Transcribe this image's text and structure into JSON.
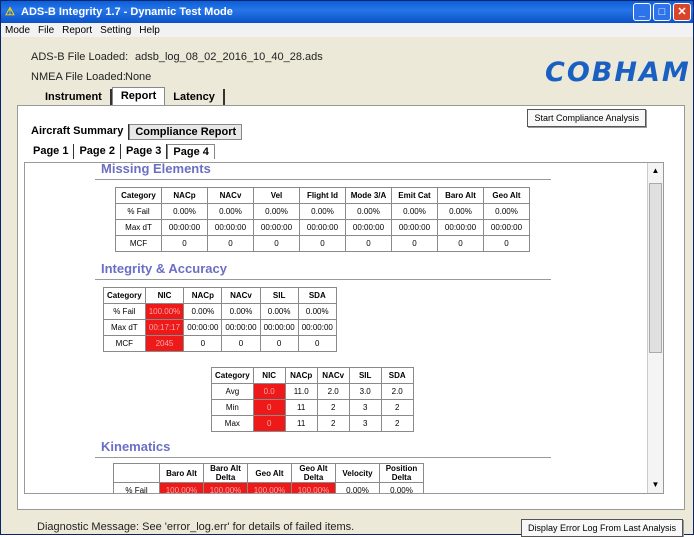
{
  "window": {
    "title": "ADS-B Integrity 1.7 - Dynamic Test Mode"
  },
  "menu": [
    "Mode",
    "File",
    "Report",
    "Setting",
    "Help"
  ],
  "files": {
    "adsb_label": "ADS-B File Loaded:",
    "adsb_value": "adsb_log_08_02_2016_10_40_28.ads",
    "nmea_label": "NMEA File Loaded:",
    "nmea_value": "None"
  },
  "logo": "COBHAM",
  "tabs": [
    "Instrument",
    "Report",
    "Latency"
  ],
  "start_button": "Start Compliance Analysis",
  "subtabs": [
    "Aircraft Summary",
    "Compliance Report"
  ],
  "pages": [
    "Page 1",
    "Page 2",
    "Page 3",
    "Page 4"
  ],
  "missing": {
    "title": "Missing Elements",
    "headers": [
      "Category",
      "NACp",
      "NACv",
      "Vel",
      "Flight Id",
      "Mode 3/A",
      "Emit Cat",
      "Baro Alt",
      "Geo Alt"
    ],
    "rows": [
      [
        "% Fail",
        "0.00%",
        "0.00%",
        "0.00%",
        "0.00%",
        "0.00%",
        "0.00%",
        "0.00%",
        "0.00%"
      ],
      [
        "Max dT",
        "00:00:00",
        "00:00:00",
        "00:00:00",
        "00:00:00",
        "00:00:00",
        "00:00:00",
        "00:00:00",
        "00:00:00"
      ],
      [
        "MCF",
        "0",
        "0",
        "0",
        "0",
        "0",
        "0",
        "0",
        "0"
      ]
    ]
  },
  "integrity": {
    "title": "Integrity & Accuracy",
    "headers": [
      "Category",
      "NIC",
      "NACp",
      "NACv",
      "SIL",
      "SDA"
    ],
    "rows": [
      [
        "% Fail",
        "100.00%",
        "0.00%",
        "0.00%",
        "0.00%",
        "0.00%"
      ],
      [
        "Max dT",
        "00:17:17",
        "00:00:00",
        "00:00:00",
        "00:00:00",
        "00:00:00"
      ],
      [
        "MCF",
        "2045",
        "0",
        "0",
        "0",
        "0"
      ]
    ],
    "stats_headers": [
      "Category",
      "NIC",
      "NACp",
      "NACv",
      "SIL",
      "SDA"
    ],
    "stats_rows": [
      [
        "Avg",
        "0.0",
        "11.0",
        "2.0",
        "3.0",
        "2.0"
      ],
      [
        "Min",
        "0",
        "11",
        "2",
        "3",
        "2"
      ],
      [
        "Max",
        "0",
        "11",
        "2",
        "3",
        "2"
      ]
    ]
  },
  "kinematics": {
    "title": "Kinematics",
    "headers": [
      "",
      "Baro Alt",
      "Baro Alt Delta",
      "Geo Alt",
      "Geo Alt Delta",
      "Velocity",
      "Position Delta"
    ],
    "rows": [
      [
        "% Fail",
        "100.00%",
        "100.00%",
        "100.00%",
        "100.00%",
        "0.00%",
        "0.00%"
      ]
    ]
  },
  "status": "Diagnostic Message:  See 'error_log.err' for details of failed items.",
  "error_button": "Display Error Log From Last Analysis",
  "colors": {
    "fail": "#ee1a1a",
    "section": "#6b6fc4",
    "logo": "#1a5fc2"
  }
}
